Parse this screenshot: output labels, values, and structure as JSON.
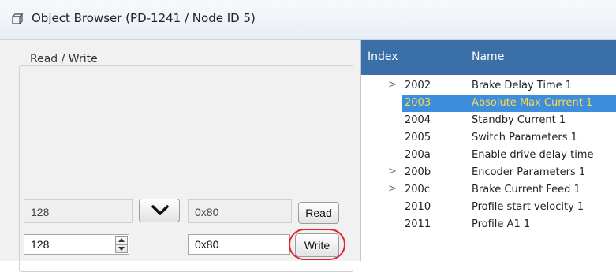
{
  "window": {
    "title": "Object Browser (PD-1241 / Node ID  5)"
  },
  "read_write": {
    "group_title": "Read / Write",
    "read_value_dec": "128",
    "read_value_hex": "0x80",
    "read_label": "Read",
    "write_value_dec": "128",
    "write_value_hex": "0x80",
    "write_label": "Write"
  },
  "table": {
    "columns": [
      "Index",
      "Name"
    ],
    "rows": [
      {
        "index": "2002",
        "name": "Brake Delay Time 1",
        "expandable": true,
        "selected": false
      },
      {
        "index": "2003",
        "name": "Absolute Max Current 1",
        "expandable": false,
        "selected": true
      },
      {
        "index": "2004",
        "name": "Standby Current 1",
        "expandable": false,
        "selected": false
      },
      {
        "index": "2005",
        "name": "Switch Parameters 1",
        "expandable": false,
        "selected": false
      },
      {
        "index": "200a",
        "name": "Enable drive delay time",
        "expandable": false,
        "selected": false
      },
      {
        "index": "200b",
        "name": "Encoder Parameters 1",
        "expandable": true,
        "selected": false
      },
      {
        "index": "200c",
        "name": "Brake Current Feed 1",
        "expandable": true,
        "selected": false
      },
      {
        "index": "2010",
        "name": "Profile start velocity 1",
        "expandable": false,
        "selected": false
      },
      {
        "index": "2011",
        "name": "Profile A1 1",
        "expandable": false,
        "selected": false
      }
    ]
  },
  "icons": {
    "window_icon": "object-browser-icon",
    "expander": "chevron-right-icon",
    "transfer": "chevron-down-icon"
  },
  "colors": {
    "header_bg": "#3a6fa8",
    "selection_bg": "#3d8fdd",
    "selection_text": "#ffd94a",
    "highlight": "#e2232f"
  }
}
